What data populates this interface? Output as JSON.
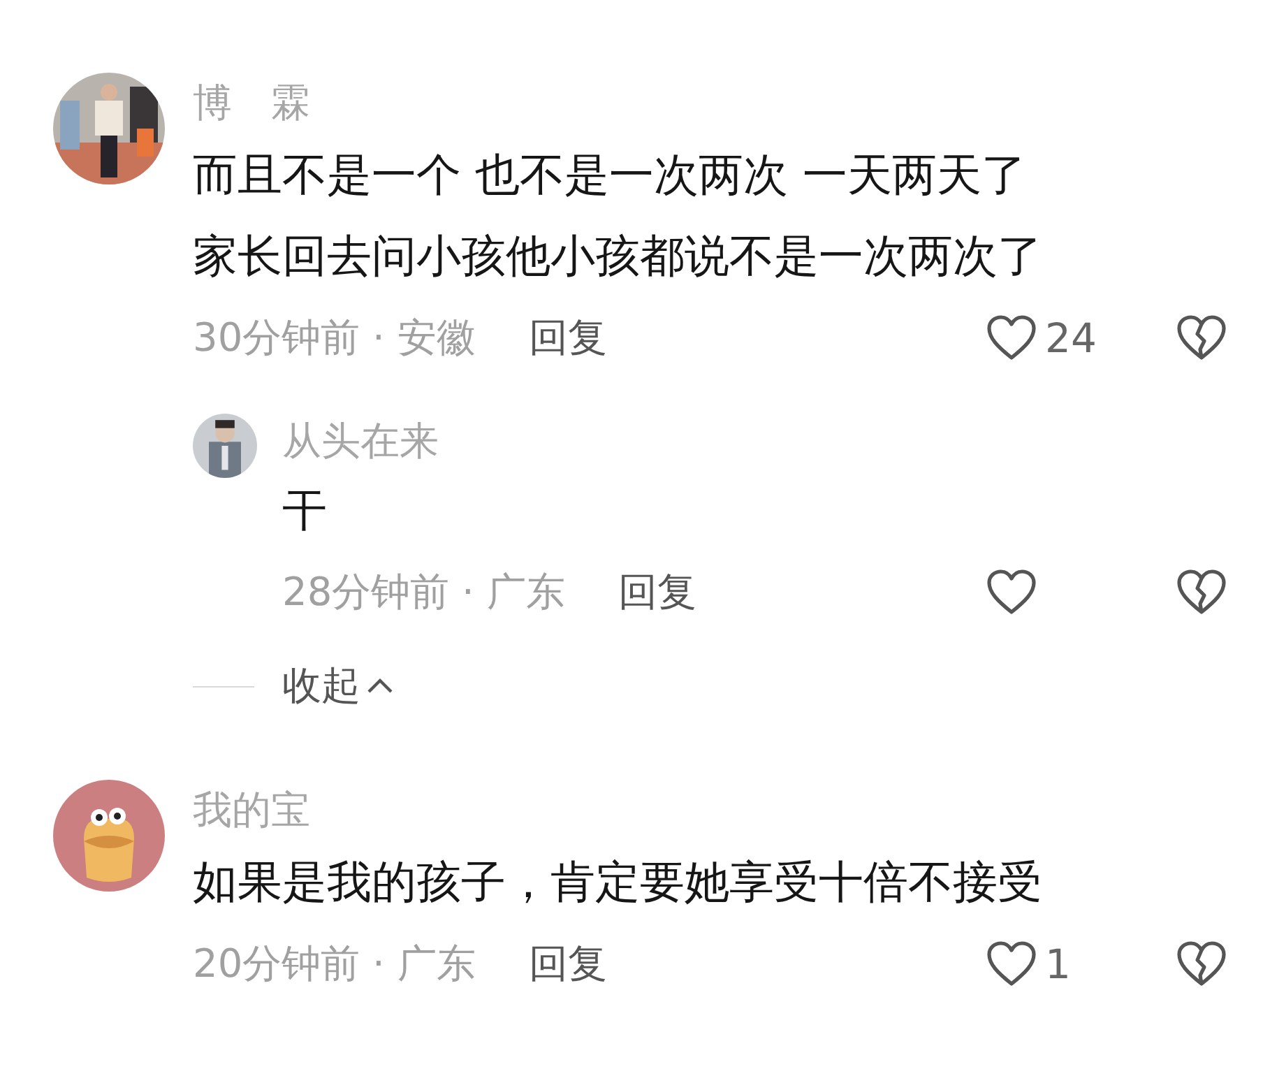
{
  "comments": [
    {
      "kind": "comment",
      "avatar": {
        "kind": "picture"
      },
      "name": "博　霖",
      "lines": [
        "而且不是一个 也不是一次两次 一天两天了",
        "家长回去问小孩他小孩都说不是一次两次了"
      ],
      "meta": "30分钟前 · 安徽",
      "reply_label": "回复",
      "likes": "24",
      "replies": [
        {
          "kind": "reply",
          "avatar": {
            "kind": "picture"
          },
          "name": "从头在来",
          "lines": [
            "干"
          ],
          "meta": "28分钟前 · 广东",
          "reply_label": "回复"
        }
      ],
      "collapse": "收起"
    },
    {
      "kind": "comment",
      "avatar": {
        "kind": "picture"
      },
      "name": "我的宝",
      "lines": [
        "如果是我的孩子，肯定要她享受十倍不接受"
      ],
      "meta": "20分钟前 · 广东",
      "reply_label": "回复",
      "likes": "1"
    }
  ]
}
